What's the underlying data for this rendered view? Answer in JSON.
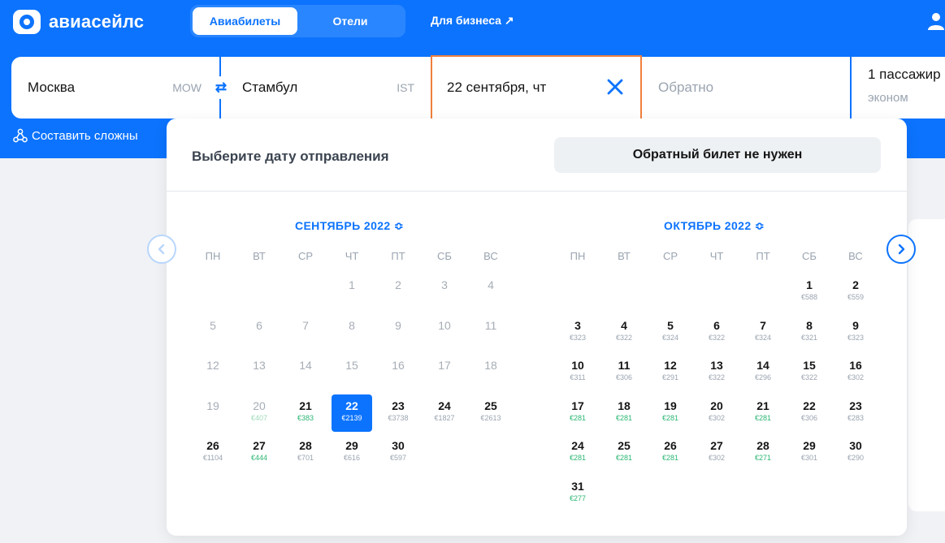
{
  "brand": {
    "name": "авиасейлс"
  },
  "tabs": [
    {
      "label": "Авиабилеты"
    },
    {
      "label": "Отели"
    }
  ],
  "business_link": "Для бизнеса ↗",
  "search": {
    "from": {
      "city": "Москва",
      "code": "MOW"
    },
    "to": {
      "city": "Стамбул",
      "code": "IST"
    },
    "depart_date": "22 сентября, чт",
    "return_placeholder": "Обратно",
    "passengers": "1 пассажир",
    "cabin_class": "эконом"
  },
  "complex_route": "Составить сложны",
  "calendar": {
    "title": "Выберите дату отправления",
    "no_return_label": "Обратный билет не нужен",
    "weekdays": [
      "ПН",
      "ВТ",
      "СР",
      "ЧТ",
      "ПТ",
      "СБ",
      "ВС"
    ],
    "accent_color": "#0c73fe",
    "cheap_color": "#2bb673",
    "months": [
      {
        "title": "СЕНТЯБРЬ 2022 ≎",
        "days": [
          {
            "d": "1",
            "col": 3,
            "row": 0,
            "past": true
          },
          {
            "d": "2",
            "col": 4,
            "row": 0,
            "past": true
          },
          {
            "d": "3",
            "col": 5,
            "row": 0,
            "past": true
          },
          {
            "d": "4",
            "col": 6,
            "row": 0,
            "past": true
          },
          {
            "d": "5",
            "col": 0,
            "row": 1,
            "past": true
          },
          {
            "d": "6",
            "col": 1,
            "row": 1,
            "past": true
          },
          {
            "d": "7",
            "col": 2,
            "row": 1,
            "past": true
          },
          {
            "d": "8",
            "col": 3,
            "row": 1,
            "past": true
          },
          {
            "d": "9",
            "col": 4,
            "row": 1,
            "past": true
          },
          {
            "d": "10",
            "col": 5,
            "row": 1,
            "past": true
          },
          {
            "d": "11",
            "col": 6,
            "row": 1,
            "past": true
          },
          {
            "d": "12",
            "col": 0,
            "row": 2,
            "past": true
          },
          {
            "d": "13",
            "col": 1,
            "row": 2,
            "past": true
          },
          {
            "d": "14",
            "col": 2,
            "row": 2,
            "past": true
          },
          {
            "d": "15",
            "col": 3,
            "row": 2,
            "past": true
          },
          {
            "d": "16",
            "col": 4,
            "row": 2,
            "past": true
          },
          {
            "d": "17",
            "col": 5,
            "row": 2,
            "past": true
          },
          {
            "d": "18",
            "col": 6,
            "row": 2,
            "past": true
          },
          {
            "d": "19",
            "col": 0,
            "row": 3,
            "past": true
          },
          {
            "d": "20",
            "col": 1,
            "row": 3,
            "past": true,
            "price": "€407",
            "tone": "pale"
          },
          {
            "d": "21",
            "col": 2,
            "row": 3,
            "price": "€383",
            "tone": "cheap"
          },
          {
            "d": "22",
            "col": 3,
            "row": 3,
            "price": "€2139",
            "selected": true
          },
          {
            "d": "23",
            "col": 4,
            "row": 3,
            "price": "€3738"
          },
          {
            "d": "24",
            "col": 5,
            "row": 3,
            "price": "€1827"
          },
          {
            "d": "25",
            "col": 6,
            "row": 3,
            "price": "€2613"
          },
          {
            "d": "26",
            "col": 0,
            "row": 4,
            "price": "€1104"
          },
          {
            "d": "27",
            "col": 1,
            "row": 4,
            "price": "€444",
            "tone": "cheap"
          },
          {
            "d": "28",
            "col": 2,
            "row": 4,
            "price": "€701"
          },
          {
            "d": "29",
            "col": 3,
            "row": 4,
            "price": "€616"
          },
          {
            "d": "30",
            "col": 4,
            "row": 4,
            "price": "€597"
          }
        ]
      },
      {
        "title": "ОКТЯБРЬ 2022 ≎",
        "days": [
          {
            "d": "1",
            "col": 5,
            "row": 0,
            "price": "€588"
          },
          {
            "d": "2",
            "col": 6,
            "row": 0,
            "price": "€559"
          },
          {
            "d": "3",
            "col": 0,
            "row": 1,
            "price": "€323"
          },
          {
            "d": "4",
            "col": 1,
            "row": 1,
            "price": "€322"
          },
          {
            "d": "5",
            "col": 2,
            "row": 1,
            "price": "€324"
          },
          {
            "d": "6",
            "col": 3,
            "row": 1,
            "price": "€322"
          },
          {
            "d": "7",
            "col": 4,
            "row": 1,
            "price": "€324"
          },
          {
            "d": "8",
            "col": 5,
            "row": 1,
            "price": "€321"
          },
          {
            "d": "9",
            "col": 6,
            "row": 1,
            "price": "€323"
          },
          {
            "d": "10",
            "col": 0,
            "row": 2,
            "price": "€311"
          },
          {
            "d": "11",
            "col": 1,
            "row": 2,
            "price": "€306"
          },
          {
            "d": "12",
            "col": 2,
            "row": 2,
            "price": "€291"
          },
          {
            "d": "13",
            "col": 3,
            "row": 2,
            "price": "€322"
          },
          {
            "d": "14",
            "col": 4,
            "row": 2,
            "price": "€296"
          },
          {
            "d": "15",
            "col": 5,
            "row": 2,
            "price": "€322"
          },
          {
            "d": "16",
            "col": 6,
            "row": 2,
            "price": "€302"
          },
          {
            "d": "17",
            "col": 0,
            "row": 3,
            "price": "€281",
            "tone": "cheap"
          },
          {
            "d": "18",
            "col": 1,
            "row": 3,
            "price": "€281",
            "tone": "cheap"
          },
          {
            "d": "19",
            "col": 2,
            "row": 3,
            "price": "€281",
            "tone": "cheap"
          },
          {
            "d": "20",
            "col": 3,
            "row": 3,
            "price": "€302"
          },
          {
            "d": "21",
            "col": 4,
            "row": 3,
            "price": "€281",
            "tone": "cheap"
          },
          {
            "d": "22",
            "col": 5,
            "row": 3,
            "price": "€306"
          },
          {
            "d": "23",
            "col": 6,
            "row": 3,
            "price": "€283"
          },
          {
            "d": "24",
            "col": 0,
            "row": 4,
            "price": "€281",
            "tone": "cheap"
          },
          {
            "d": "25",
            "col": 1,
            "row": 4,
            "price": "€281",
            "tone": "cheap"
          },
          {
            "d": "26",
            "col": 2,
            "row": 4,
            "price": "€281",
            "tone": "cheap"
          },
          {
            "d": "27",
            "col": 3,
            "row": 4,
            "price": "€302"
          },
          {
            "d": "28",
            "col": 4,
            "row": 4,
            "price": "€271",
            "tone": "cheap"
          },
          {
            "d": "29",
            "col": 5,
            "row": 4,
            "price": "€301"
          },
          {
            "d": "30",
            "col": 6,
            "row": 4,
            "price": "€290"
          },
          {
            "d": "31",
            "col": 0,
            "row": 5,
            "price": "€277",
            "tone": "cheap"
          }
        ]
      }
    ]
  }
}
